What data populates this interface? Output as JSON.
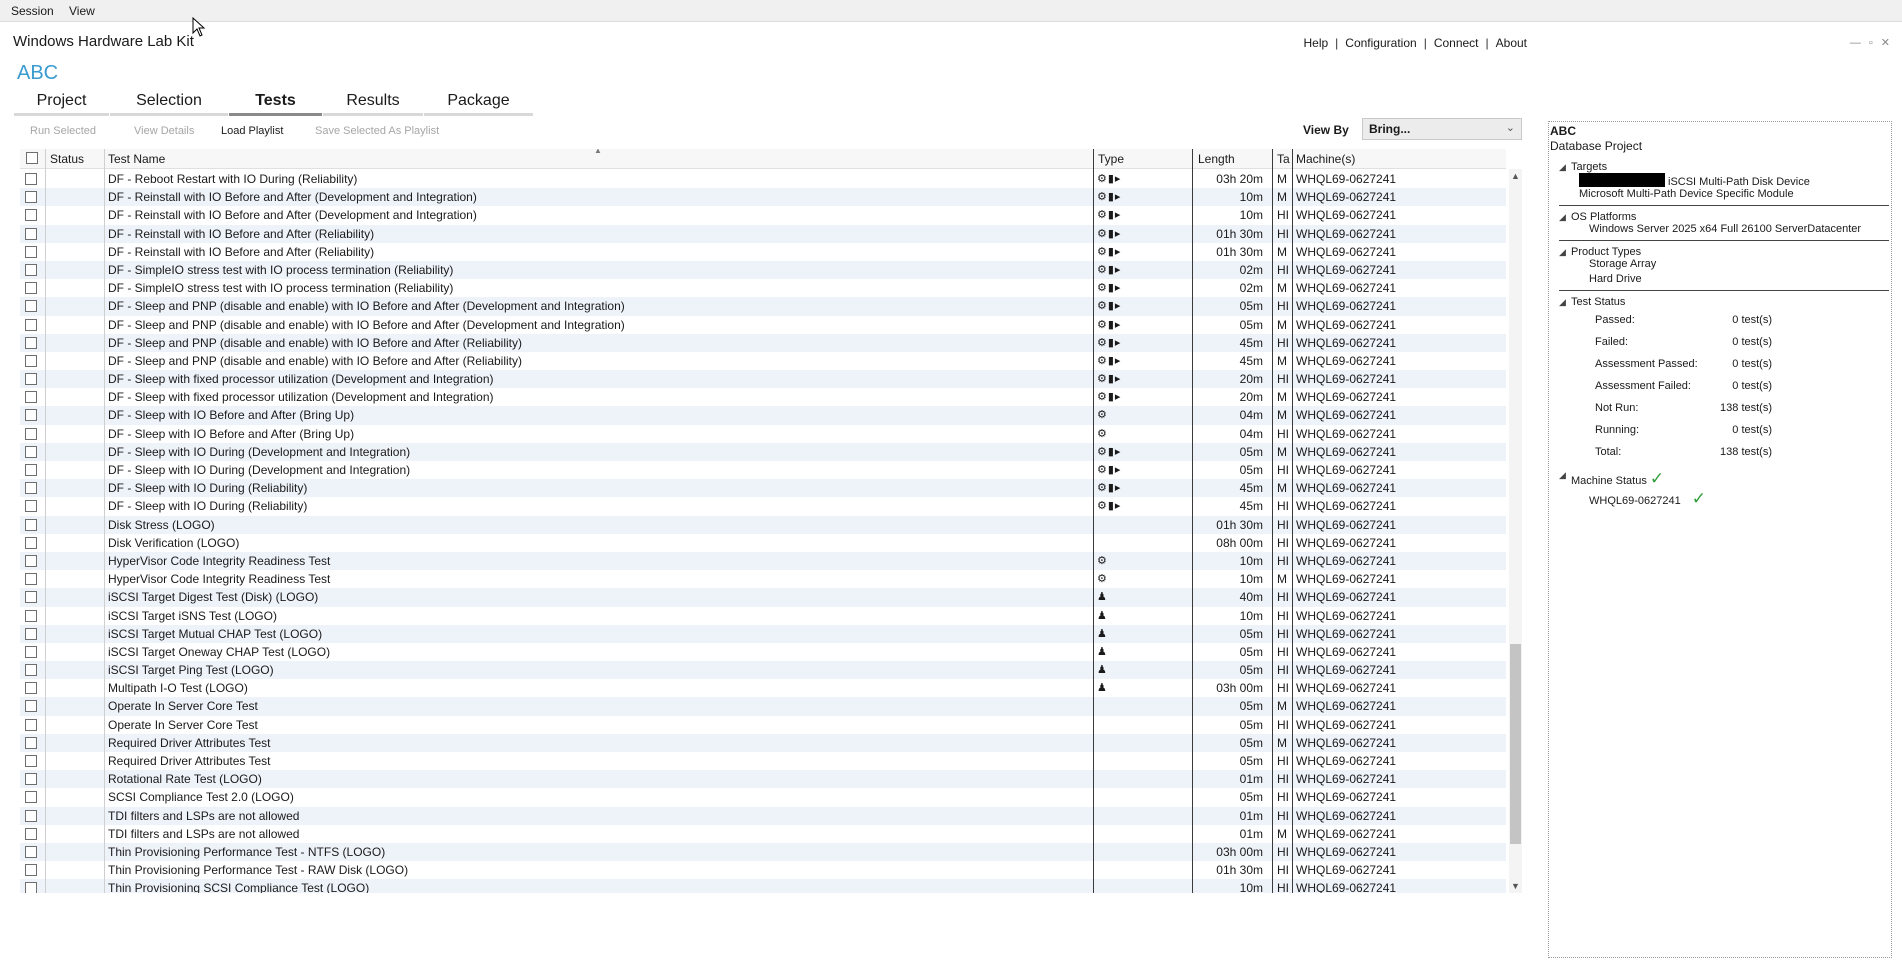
{
  "menu": {
    "session": "Session",
    "view": "View"
  },
  "app_title": "Windows Hardware Lab Kit",
  "top_links": {
    "help": "Help",
    "configuration": "Configuration",
    "connect": "Connect",
    "about": "About",
    "sep": "|"
  },
  "project_name": "ABC",
  "tabs": [
    {
      "label": "Project"
    },
    {
      "label": "Selection"
    },
    {
      "label": "Tests",
      "active": true
    },
    {
      "label": "Results"
    },
    {
      "label": "Package"
    }
  ],
  "toolbar": {
    "run_selected": "Run Selected",
    "view_details": "View Details",
    "load_playlist": "Load Playlist",
    "save_playlist": "Save Selected As Playlist"
  },
  "view_by": {
    "label": "View By",
    "value": "Bring..."
  },
  "columns": {
    "status": "Status",
    "test_name": "Test Name",
    "type": "Type",
    "length": "Length",
    "ta": "Ta",
    "machines": "Machine(s)"
  },
  "rows": [
    {
      "name": "DF - Reboot Restart with IO During (Reliability)",
      "type": "⚙▮▸",
      "length": "03h 20m",
      "ta": "M",
      "machine": "WHQL69-0627241"
    },
    {
      "name": "DF - Reinstall with IO Before and After (Development and Integration)",
      "type": "⚙▮▸",
      "length": "10m",
      "ta": "M",
      "machine": "WHQL69-0627241"
    },
    {
      "name": "DF - Reinstall with IO Before and After (Development and Integration)",
      "type": "⚙▮▸",
      "length": "10m",
      "ta": "HI",
      "machine": "WHQL69-0627241"
    },
    {
      "name": "DF - Reinstall with IO Before and After (Reliability)",
      "type": "⚙▮▸",
      "length": "01h 30m",
      "ta": "HI",
      "machine": "WHQL69-0627241"
    },
    {
      "name": "DF - Reinstall with IO Before and After (Reliability)",
      "type": "⚙▮▸",
      "length": "01h 30m",
      "ta": "M",
      "machine": "WHQL69-0627241"
    },
    {
      "name": "DF - SimpleIO stress test with IO process termination (Reliability)",
      "type": "⚙▮▸",
      "length": "02m",
      "ta": "HI",
      "machine": "WHQL69-0627241"
    },
    {
      "name": "DF - SimpleIO stress test with IO process termination (Reliability)",
      "type": "⚙▮▸",
      "length": "02m",
      "ta": "M",
      "machine": "WHQL69-0627241"
    },
    {
      "name": "DF - Sleep and PNP (disable and enable) with IO Before and After (Development and Integration)",
      "type": "⚙▮▸",
      "length": "05m",
      "ta": "HI",
      "machine": "WHQL69-0627241"
    },
    {
      "name": "DF - Sleep and PNP (disable and enable) with IO Before and After (Development and Integration)",
      "type": "⚙▮▸",
      "length": "05m",
      "ta": "M",
      "machine": "WHQL69-0627241"
    },
    {
      "name": "DF - Sleep and PNP (disable and enable) with IO Before and After (Reliability)",
      "type": "⚙▮▸",
      "length": "45m",
      "ta": "HI",
      "machine": "WHQL69-0627241"
    },
    {
      "name": "DF - Sleep and PNP (disable and enable) with IO Before and After (Reliability)",
      "type": "⚙▮▸",
      "length": "45m",
      "ta": "M",
      "machine": "WHQL69-0627241"
    },
    {
      "name": "DF - Sleep with fixed processor utilization (Development and Integration)",
      "type": "⚙▮▸",
      "length": "20m",
      "ta": "HI",
      "machine": "WHQL69-0627241"
    },
    {
      "name": "DF - Sleep with fixed processor utilization (Development and Integration)",
      "type": "⚙▮▸",
      "length": "20m",
      "ta": "M",
      "machine": "WHQL69-0627241"
    },
    {
      "name": "DF - Sleep with IO Before and After (Bring Up)",
      "type": "⚙",
      "length": "04m",
      "ta": "M",
      "machine": "WHQL69-0627241"
    },
    {
      "name": "DF - Sleep with IO Before and After (Bring Up)",
      "type": "⚙",
      "length": "04m",
      "ta": "HI",
      "machine": "WHQL69-0627241"
    },
    {
      "name": "DF - Sleep with IO During (Development and Integration)",
      "type": "⚙▮▸",
      "length": "05m",
      "ta": "M",
      "machine": "WHQL69-0627241"
    },
    {
      "name": "DF - Sleep with IO During (Development and Integration)",
      "type": "⚙▮▸",
      "length": "05m",
      "ta": "HI",
      "machine": "WHQL69-0627241"
    },
    {
      "name": "DF - Sleep with IO During (Reliability)",
      "type": "⚙▮▸",
      "length": "45m",
      "ta": "M",
      "machine": "WHQL69-0627241"
    },
    {
      "name": "DF - Sleep with IO During (Reliability)",
      "type": "⚙▮▸",
      "length": "45m",
      "ta": "HI",
      "machine": "WHQL69-0627241"
    },
    {
      "name": "Disk Stress (LOGO)",
      "type": "",
      "length": "01h 30m",
      "ta": "HI",
      "machine": "WHQL69-0627241"
    },
    {
      "name": "Disk Verification (LOGO)",
      "type": "",
      "length": "08h 00m",
      "ta": "HI",
      "machine": "WHQL69-0627241"
    },
    {
      "name": "HyperVisor Code Integrity Readiness Test",
      "type": "⚙",
      "length": "10m",
      "ta": "HI",
      "machine": "WHQL69-0627241"
    },
    {
      "name": "HyperVisor Code Integrity Readiness Test",
      "type": "⚙",
      "length": "10m",
      "ta": "M",
      "machine": "WHQL69-0627241"
    },
    {
      "name": "iSCSI Target Digest Test (Disk) (LOGO)",
      "type": "♟",
      "length": "40m",
      "ta": "HI",
      "machine": "WHQL69-0627241"
    },
    {
      "name": "iSCSI Target iSNS Test (LOGO)",
      "type": "♟",
      "length": "10m",
      "ta": "HI",
      "machine": "WHQL69-0627241"
    },
    {
      "name": "iSCSI Target Mutual CHAP Test (LOGO)",
      "type": "♟",
      "length": "05m",
      "ta": "HI",
      "machine": "WHQL69-0627241"
    },
    {
      "name": "iSCSI Target Oneway CHAP Test (LOGO)",
      "type": "♟",
      "length": "05m",
      "ta": "HI",
      "machine": "WHQL69-0627241"
    },
    {
      "name": "iSCSI Target Ping Test (LOGO)",
      "type": "♟",
      "length": "05m",
      "ta": "HI",
      "machine": "WHQL69-0627241"
    },
    {
      "name": "Multipath I-O Test (LOGO)",
      "type": "♟",
      "length": "03h 00m",
      "ta": "HI",
      "machine": "WHQL69-0627241"
    },
    {
      "name": "Operate In Server Core Test",
      "type": "",
      "length": "05m",
      "ta": "M",
      "machine": "WHQL69-0627241"
    },
    {
      "name": "Operate In Server Core Test",
      "type": "",
      "length": "05m",
      "ta": "HI",
      "machine": "WHQL69-0627241"
    },
    {
      "name": "Required Driver Attributes Test",
      "type": "",
      "length": "05m",
      "ta": "M",
      "machine": "WHQL69-0627241"
    },
    {
      "name": "Required Driver Attributes Test",
      "type": "",
      "length": "05m",
      "ta": "HI",
      "machine": "WHQL69-0627241"
    },
    {
      "name": "Rotational Rate Test (LOGO)",
      "type": "",
      "length": "01m",
      "ta": "HI",
      "machine": "WHQL69-0627241"
    },
    {
      "name": "SCSI Compliance Test 2.0 (LOGO)",
      "type": "",
      "length": "05m",
      "ta": "HI",
      "machine": "WHQL69-0627241"
    },
    {
      "name": "TDI filters and LSPs are not allowed",
      "type": "",
      "length": "01m",
      "ta": "HI",
      "machine": "WHQL69-0627241"
    },
    {
      "name": "TDI filters and LSPs are not allowed",
      "type": "",
      "length": "01m",
      "ta": "M",
      "machine": "WHQL69-0627241"
    },
    {
      "name": "Thin Provisioning Performance Test - NTFS (LOGO)",
      "type": "",
      "length": "03h 00m",
      "ta": "HI",
      "machine": "WHQL69-0627241"
    },
    {
      "name": "Thin Provisioning Performance Test - RAW Disk (LOGO)",
      "type": "",
      "length": "01h 30m",
      "ta": "HI",
      "machine": "WHQL69-0627241"
    },
    {
      "name": "Thin Provisioning SCSI Compliance Test (LOGO)",
      "type": "",
      "length": "10m",
      "ta": "HI",
      "machine": "WHQL69-0627241"
    }
  ],
  "panel": {
    "title": "ABC",
    "subtitle": "Database Project",
    "targets": {
      "label": "Targets",
      "items": [
        "iSCSI  Multi-Path Disk Device",
        "Microsoft Multi-Path Device Specific Module"
      ]
    },
    "os_platforms": {
      "label": "OS Platforms",
      "items": [
        "Windows Server 2025 x64 Full 26100 ServerDatacenter"
      ]
    },
    "product_types": {
      "label": "Product Types",
      "items": [
        "Storage Array",
        "Hard Drive"
      ]
    },
    "test_status": {
      "label": "Test Status",
      "stats": [
        {
          "label": "Passed:",
          "value": "0 test(s)"
        },
        {
          "label": "Failed:",
          "value": "0 test(s)"
        },
        {
          "label": "Assessment Passed:",
          "value": "0 test(s)"
        },
        {
          "label": "Assessment Failed:",
          "value": "0 test(s)"
        },
        {
          "label": "Not Run:",
          "value": "138 test(s)"
        },
        {
          "label": "Running:",
          "value": "0 test(s)"
        },
        {
          "label": "Total:",
          "value": "138 test(s)"
        }
      ]
    },
    "machine_status": {
      "label": "Machine Status",
      "machine": "WHQL69-0627241"
    }
  }
}
